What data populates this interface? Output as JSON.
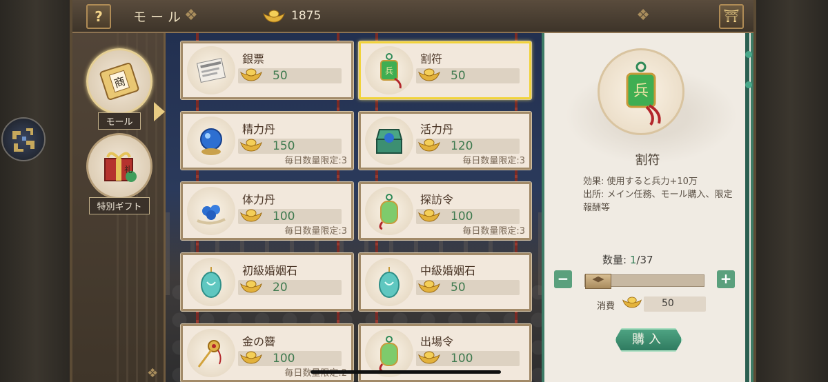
{
  "topbar": {
    "help_label": "?",
    "title": "モール",
    "currency_amount": "1875"
  },
  "tabs": [
    {
      "label": "モール",
      "active": true
    },
    {
      "label": "特別ギフト",
      "active": false
    }
  ],
  "items": [
    {
      "name": "銀票",
      "price": "50",
      "limit": "",
      "icon": "paper-money-icon"
    },
    {
      "name": "割符",
      "price": "50",
      "limit": "",
      "icon": "tally-token-icon"
    },
    {
      "name": "精力丹",
      "price": "150",
      "limit": "毎日数量限定:3",
      "icon": "blue-pill-icon"
    },
    {
      "name": "活力丹",
      "price": "120",
      "limit": "毎日数量限定:3",
      "icon": "treasure-chest-icon"
    },
    {
      "name": "体力丹",
      "price": "100",
      "limit": "毎日数量限定:3",
      "icon": "blue-pills-icon"
    },
    {
      "name": "探訪令",
      "price": "100",
      "limit": "毎日数量限定:3",
      "icon": "green-token-icon"
    },
    {
      "name": "初級婚姻石",
      "price": "20",
      "limit": "",
      "icon": "jade-stone-icon"
    },
    {
      "name": "中級婚姻石",
      "price": "50",
      "limit": "",
      "icon": "jade-stone-icon"
    },
    {
      "name": "金の簪",
      "price": "100",
      "limit": "毎日数量限定:2",
      "icon": "hairpin-icon"
    },
    {
      "name": "出場令",
      "price": "100",
      "limit": "",
      "icon": "green-token-icon"
    }
  ],
  "detail": {
    "name": "割符",
    "description": "効果: 使用すると兵力+10万\n出所: メイン任務、モール購入、限定報酬等",
    "qty_label": "数量:",
    "qty_current": "1",
    "qty_max": "/37",
    "cost_label": "消費",
    "cost_value": "50",
    "buy_label": "購入"
  },
  "colors": {
    "selected_border": "#f1d33a",
    "price_green": "#3f7a4f",
    "panel_teal": "#3d7b66"
  }
}
